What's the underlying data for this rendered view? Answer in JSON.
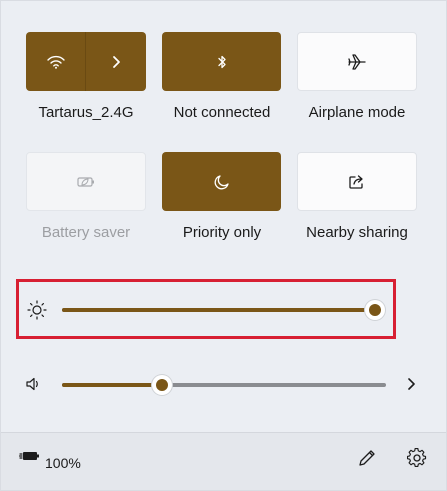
{
  "quick_settings": {
    "tiles": [
      {
        "id": "wifi",
        "label": "Tartarus_2.4G",
        "state": "on",
        "icon": "wifi-icon",
        "has_chevron": true
      },
      {
        "id": "bluetooth",
        "label": "Not connected",
        "state": "on",
        "icon": "bluetooth-icon"
      },
      {
        "id": "airplane",
        "label": "Airplane mode",
        "state": "off",
        "icon": "airplane-icon"
      },
      {
        "id": "battery_saver",
        "label": "Battery saver",
        "state": "disabled",
        "icon": "battery-saver-icon"
      },
      {
        "id": "focus_assist",
        "label": "Priority only",
        "state": "on",
        "icon": "moon-icon"
      },
      {
        "id": "nearby_sharing",
        "label": "Nearby sharing",
        "state": "off",
        "icon": "share-icon"
      }
    ]
  },
  "sliders": {
    "brightness": {
      "icon": "brightness-icon",
      "level": 1.0,
      "highlighted": true
    },
    "volume": {
      "icon": "speaker-icon",
      "level": 0.31,
      "chevron_icon": "chevron-right-icon"
    }
  },
  "footer": {
    "battery_icon": "battery-charging-icon",
    "battery_percent": "100%",
    "edit_icon": "pencil-icon",
    "settings_icon": "gear-icon"
  },
  "colors": {
    "accent": "#7a5617",
    "highlight": "#d71f32",
    "panel_bg": "#ebeef3"
  }
}
